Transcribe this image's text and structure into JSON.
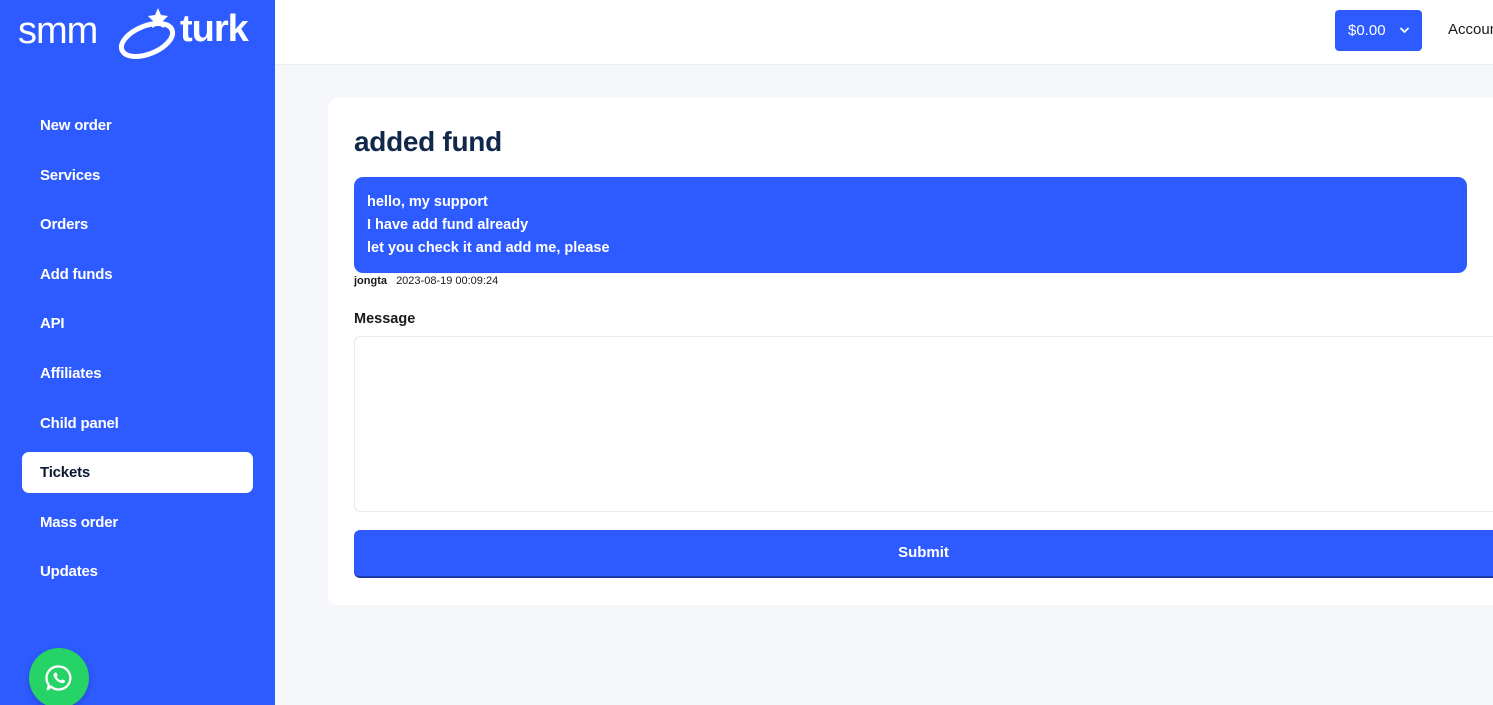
{
  "brand": {
    "part1": "smm",
    "part2": "turk"
  },
  "sidebar": {
    "items": [
      {
        "label": "New order"
      },
      {
        "label": "Services"
      },
      {
        "label": "Orders"
      },
      {
        "label": "Add funds"
      },
      {
        "label": "API"
      },
      {
        "label": "Affiliates"
      },
      {
        "label": "Child panel"
      },
      {
        "label": "Tickets",
        "active": true
      },
      {
        "label": "Mass order"
      },
      {
        "label": "Updates"
      }
    ],
    "whatsapp_icon": "whatsapp-icon"
  },
  "header": {
    "balance": "$0.00",
    "account_label": "Accoun"
  },
  "ticket": {
    "title": "added fund",
    "message": {
      "lines": [
        "hello, my support",
        "I have add fund already",
        "let you check it and add me, please"
      ],
      "author": "jongta",
      "timestamp": "2023-08-19 00:09:24"
    },
    "reply": {
      "label": "Message",
      "value": "",
      "submit_label": "Submit"
    }
  },
  "colors": {
    "accent": "#2e5bff",
    "sidebar_bg": "#2e5bff",
    "page_bg": "#f6f7fb",
    "title": "#12284a",
    "whatsapp": "#25d366"
  }
}
